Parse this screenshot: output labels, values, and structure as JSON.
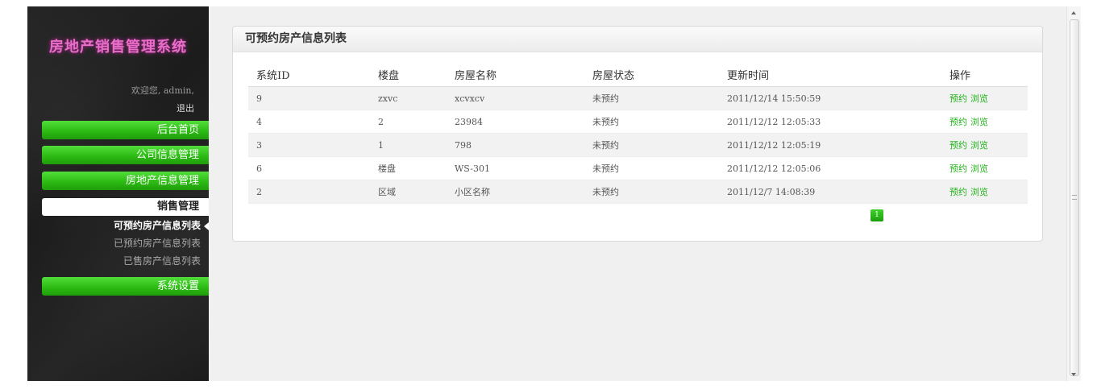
{
  "sidebar": {
    "title": "房地产销售管理系统",
    "welcome": "欢迎您, admin,",
    "logout": "退出",
    "nav": {
      "home": "后台首页",
      "company": "公司信息管理",
      "realestate": "房地产信息管理",
      "sales": "销售管理",
      "settings": "系统设置"
    },
    "sub_items": [
      "可预约房产信息列表",
      "已预约房产信息列表",
      "已售房产信息列表"
    ]
  },
  "panel": {
    "title": "可预约房产信息列表",
    "columns": [
      "系统ID",
      "楼盘",
      "房屋名称",
      "房屋状态",
      "更新时间",
      "操作"
    ],
    "rows": [
      {
        "id": "9",
        "building": "zxvc",
        "name": "xcvxcv",
        "status": "未预约",
        "updated": "2011/12/14 15:50:59"
      },
      {
        "id": "4",
        "building": "2",
        "name": "23984",
        "status": "未预约",
        "updated": "2011/12/12 12:05:33"
      },
      {
        "id": "3",
        "building": "1",
        "name": "798",
        "status": "未预约",
        "updated": "2011/12/12 12:05:19"
      },
      {
        "id": "6",
        "building": "楼盘",
        "name": "WS-301",
        "status": "未预约",
        "updated": "2011/12/12 12:05:06"
      },
      {
        "id": "2",
        "building": "区域",
        "name": "小区名称",
        "status": "未预约",
        "updated": "2011/12/7 14:08:39"
      }
    ],
    "actions": {
      "reserve": "预约",
      "view": "浏览"
    },
    "pagination": {
      "current_page": "1"
    }
  },
  "colors": {
    "accent_green": "#2dbb14",
    "title_pink": "#e86fc8",
    "link_green": "#22b21a"
  }
}
